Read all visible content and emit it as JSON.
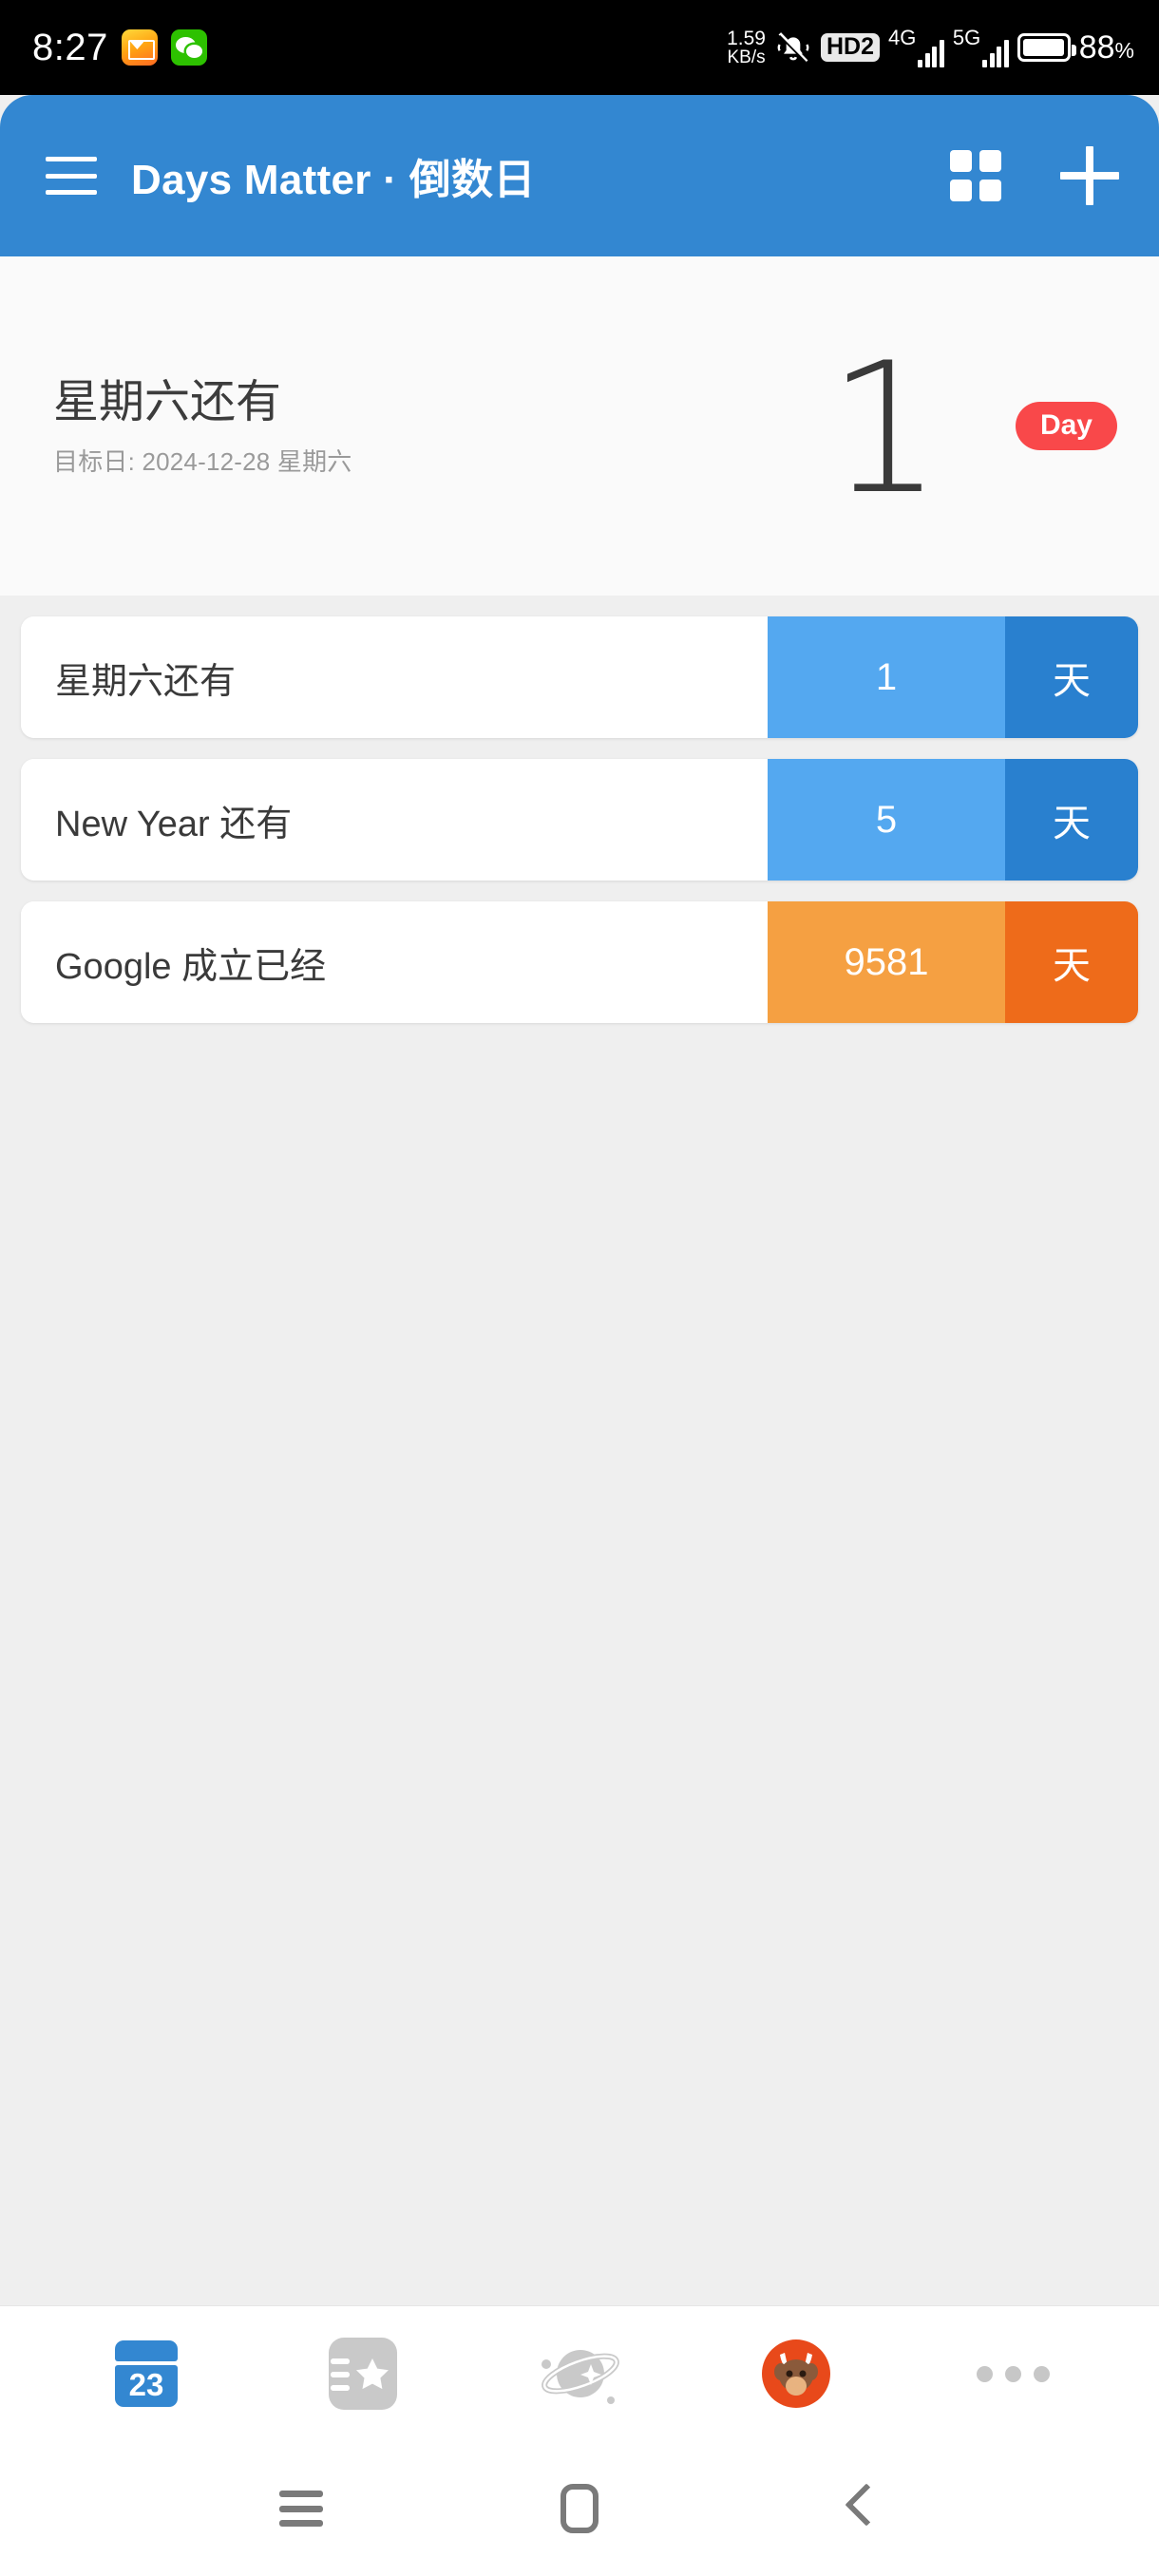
{
  "status_bar": {
    "time": "8:27",
    "icons_left": [
      "mail-icon",
      "wechat-icon"
    ],
    "network_speed_value": "1.59",
    "network_speed_unit": "KB/s",
    "silent_icon": "bell-muted-icon",
    "volte_badge": "HD2",
    "sim1_label": "4G",
    "sim2_label": "5G",
    "battery_percent": "88",
    "battery_percent_symbol": "%"
  },
  "app_bar": {
    "menu_icon": "hamburger-menu-icon",
    "title": "Days Matter · 倒数日",
    "grid_icon": "grid-view-icon",
    "add_icon": "plus-icon"
  },
  "hero": {
    "title": "星期六还有",
    "subtitle": "目标日: 2024-12-28 星期六",
    "number": "1",
    "unit_badge": "Day",
    "badge_color": "#F9484A"
  },
  "events": [
    {
      "label": "星期六还有",
      "count": "1",
      "unit": "天",
      "count_color": "#54A8F0",
      "unit_color": "#2980CF"
    },
    {
      "label": "New Year 还有",
      "count": "5",
      "unit": "天",
      "count_color": "#54A8F0",
      "unit_color": "#2980CF"
    },
    {
      "label": "Google 成立已经",
      "count": "9581",
      "unit": "天",
      "count_color": "#F5A042",
      "unit_color": "#EE6B1A"
    }
  ],
  "dock": {
    "items": [
      {
        "name": "calendar-icon",
        "badge_text": "23",
        "active": true
      },
      {
        "name": "bookmark-star-icon",
        "active": false
      },
      {
        "name": "planet-icon",
        "active": false
      },
      {
        "name": "bull-avatar-icon",
        "active": false
      },
      {
        "name": "more-dots-icon",
        "active": false
      }
    ]
  },
  "system_nav": {
    "recents": "recents-icon",
    "home": "home-icon",
    "back": "back-icon"
  },
  "theme": {
    "primary": "#3387D1",
    "hero_bg": "#FAFAFA",
    "list_bg": "#EFEFEF",
    "card_bg": "#FFFFFF"
  }
}
